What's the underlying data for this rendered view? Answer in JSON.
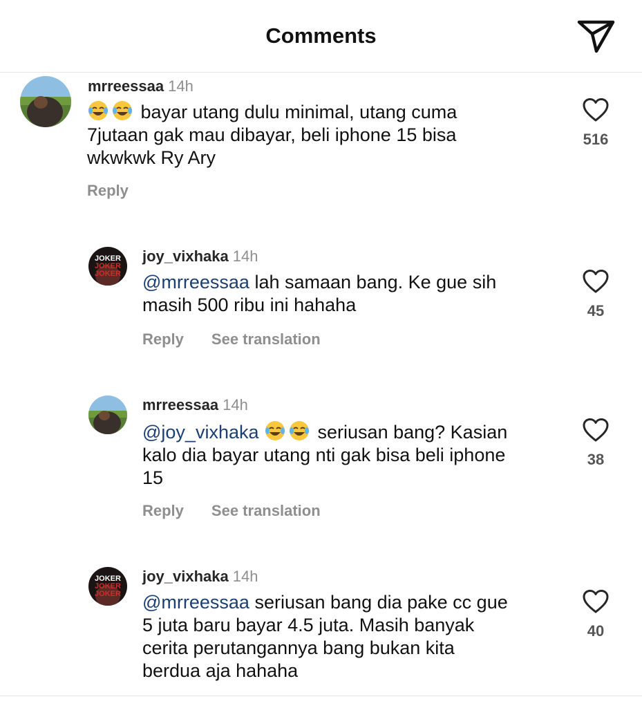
{
  "header": {
    "title": "Comments",
    "share_icon": "paper-plane-icon"
  },
  "comments": [
    {
      "username": "mrreessaa",
      "time": "14h",
      "emojis": [
        "tears-of-joy-emoji",
        "tears-of-joy-emoji"
      ],
      "lines": [
        "bayar utang dulu minimal, utang cuma",
        "7jutaan gak mau dibayar, beli iphone 15 bisa",
        "wkwkwk Ry Ary"
      ],
      "reply_label": "Reply",
      "likes": "516"
    },
    {
      "username": "joy_vixhaka",
      "time": "14h",
      "mention": "@mrreessaa",
      "lines": [
        "lah samaan bang. Ke gue sih",
        "masih 500 ribu ini hahaha"
      ],
      "reply_label": "Reply",
      "translate_label": "See translation",
      "likes": "45"
    },
    {
      "username": "mrreessaa",
      "time": "14h",
      "mention": "@joy_vixhaka",
      "emojis": [
        "tears-of-joy-emoji",
        "tears-of-joy-emoji"
      ],
      "lines": [
        "seriusan bang? Kasian",
        "kalo dia bayar utang nti gak bisa beli iphone",
        "15"
      ],
      "reply_label": "Reply",
      "translate_label": "See translation",
      "likes": "38"
    },
    {
      "username": "joy_vixhaka",
      "time": "14h",
      "mention": "@mrreessaa",
      "lines": [
        "seriusan bang dia pake cc gue",
        "5 juta baru bayar 4.5 juta. Masih banyak",
        "cerita perutangannya bang bukan kita",
        "berdua aja hahaha"
      ],
      "likes": "40"
    }
  ],
  "avatar_badge": "JOKER"
}
